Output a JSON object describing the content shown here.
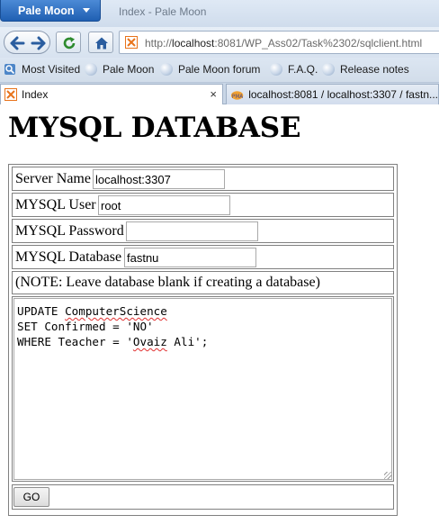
{
  "browser": {
    "app_button_label": "Pale Moon",
    "window_title": "Index - Pale Moon",
    "url_prefix": "http://",
    "url_host": "localhost",
    "url_rest": ":8081/WP_Ass02/Task%2302/sqlclient.html",
    "bookmarks": [
      {
        "label": "Most Visited"
      },
      {
        "label": "Pale Moon"
      },
      {
        "label": "Pale Moon forum"
      },
      {
        "label": "F.A.Q."
      },
      {
        "label": "Release notes"
      }
    ],
    "tabs": [
      {
        "label": "Index",
        "close": "×"
      },
      {
        "label": "localhost:8081 / localhost:3307 / fastn..."
      }
    ]
  },
  "page": {
    "heading": "MYSQL DATABASE",
    "fields": {
      "server_name": {
        "label": "Server Name",
        "value": "localhost:3307"
      },
      "user": {
        "label": "MYSQL User",
        "value": "root"
      },
      "password": {
        "label": "MYSQL Password",
        "value": ""
      },
      "database": {
        "label": "MYSQL Database",
        "value": "fastnu"
      }
    },
    "note": "(NOTE: Leave database blank if creating a database)",
    "query": {
      "line1_kw": "UPDATE ",
      "line1_table": "ComputerScience",
      "line2": "SET Confirmed = 'NO'",
      "line3_pre": "WHERE Teacher = '",
      "line3_name": "Ovaiz",
      "line3_post": " Ali';"
    },
    "go_button": "GO"
  },
  "colors": {
    "app_button": "#2a6cc4",
    "chrome": "#d7e2ef",
    "spellcheck": "#e03030"
  }
}
